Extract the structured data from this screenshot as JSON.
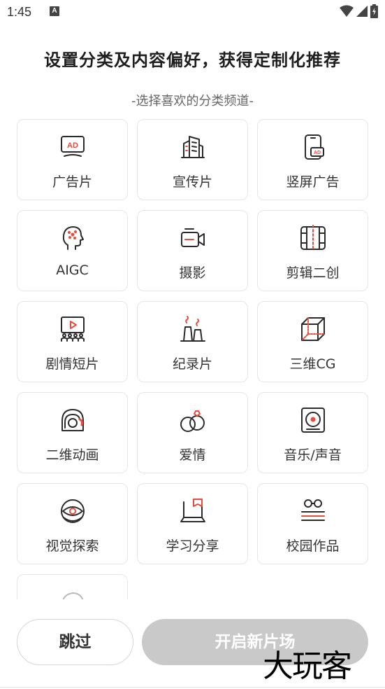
{
  "status_bar": {
    "time": "1:45",
    "notification_icon": "A",
    "icons": [
      "wifi-icon",
      "signal-icon",
      "battery-charging-icon"
    ]
  },
  "header": {
    "title": "设置分类及内容偏好，获得定制化推荐",
    "subtitle": "-选择喜欢的分类频道-"
  },
  "categories": [
    {
      "label": "广告片",
      "icon": "ad-screen-icon"
    },
    {
      "label": "宣传片",
      "icon": "buildings-icon"
    },
    {
      "label": "竖屏广告",
      "icon": "phone-ad-icon"
    },
    {
      "label": "AIGC",
      "icon": "ai-head-icon"
    },
    {
      "label": "摄影",
      "icon": "camera-icon"
    },
    {
      "label": "剪辑二创",
      "icon": "film-cut-icon"
    },
    {
      "label": "剧情短片",
      "icon": "theater-icon"
    },
    {
      "label": "纪录片",
      "icon": "factory-icon"
    },
    {
      "label": "三维CG",
      "icon": "cube-icon"
    },
    {
      "label": "二维动画",
      "icon": "astronaut-helmet-icon"
    },
    {
      "label": "爱情",
      "icon": "rings-icon"
    },
    {
      "label": "音乐/声音",
      "icon": "music-player-icon"
    },
    {
      "label": "视觉探索",
      "icon": "eye-icon"
    },
    {
      "label": "学习分享",
      "icon": "laptop-book-icon"
    },
    {
      "label": "校园作品",
      "icon": "glasses-books-icon"
    },
    {
      "label": "",
      "icon": "partial-hidden-icon"
    }
  ],
  "footer": {
    "skip_label": "跳过",
    "start_label": "开启新片场"
  },
  "watermark": "大玩客",
  "colors": {
    "accent": "#e84c3d",
    "icon_stroke": "#2b2b2b",
    "disabled_button": "#c9c9c9"
  }
}
